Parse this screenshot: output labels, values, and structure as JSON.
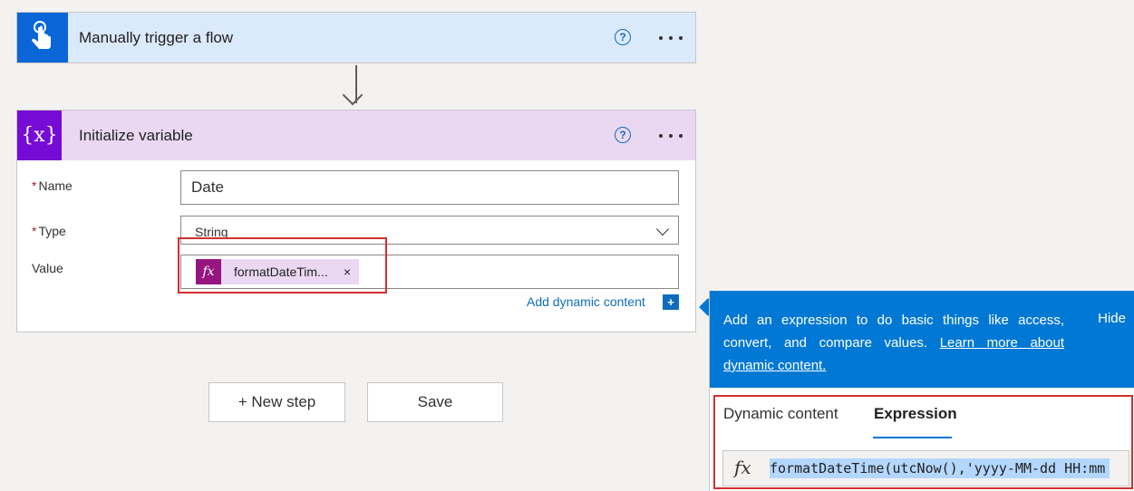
{
  "trigger": {
    "title": "Manually trigger a flow",
    "help": "?",
    "icon": "hand-touch-icon"
  },
  "init": {
    "title": "Initialize variable",
    "help": "?",
    "icon_text": "{x}",
    "fields": {
      "name_label": "Name",
      "name_value": "Date",
      "type_label": "Type",
      "type_value": "String",
      "value_label": "Value",
      "required_mark": "*",
      "token_icon": "fx",
      "token_text": "formatDateTim...",
      "token_remove": "×"
    },
    "add_dynamic": "Add dynamic content",
    "add_plus": "+"
  },
  "buttons": {
    "new_step": "+ New step",
    "save": "Save"
  },
  "panel": {
    "message": "Add an expression to do basic things like access, convert, and compare values.",
    "link": "Learn more about dynamic content.",
    "hide": "Hide",
    "tabs": [
      "Dynamic content",
      "Expression"
    ],
    "active_tab": "Expression",
    "expression_icon": "fx",
    "expression": "formatDateTime(utcNow(),'yyyy-MM-dd HH:mm"
  },
  "colors": {
    "trigger_header": "#dbe9fc",
    "trigger_icon": "#0a66d6",
    "variable_header": "#ead8f3",
    "variable_icon": "#770bd6",
    "token_icon": "#96157f",
    "accent": "#0078d4",
    "highlight_box": "#d32f2f"
  }
}
